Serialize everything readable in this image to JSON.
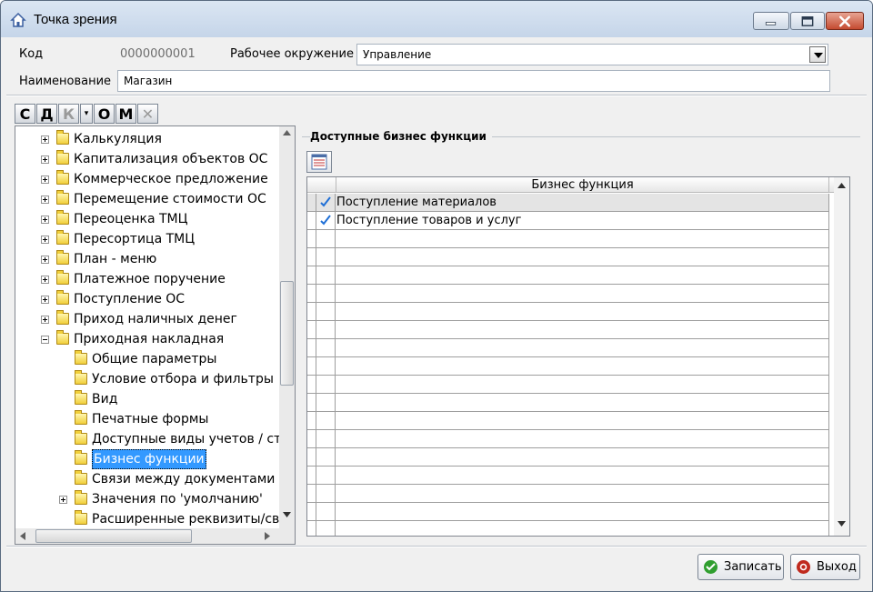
{
  "window": {
    "title": "Точка зрения",
    "icon": "home-icon"
  },
  "header": {
    "code_label": "Код",
    "code_value": "0000000001",
    "env_label": "Рабочее окружение",
    "env_value": "Управление",
    "name_label": "Наименование",
    "name_value": "Магазин"
  },
  "toolbar": {
    "buttons": [
      "С",
      "Д",
      "К",
      "▾",
      "О",
      "М",
      "✕"
    ]
  },
  "tree": {
    "items": [
      {
        "label": "Калькуляция",
        "level": 1,
        "expander": "plus"
      },
      {
        "label": "Капитализация объектов ОС",
        "level": 1,
        "expander": "plus"
      },
      {
        "label": "Коммерческое предложение",
        "level": 1,
        "expander": "plus"
      },
      {
        "label": "Перемещение стоимости ОС",
        "level": 1,
        "expander": "plus"
      },
      {
        "label": "Переоценка ТМЦ",
        "level": 1,
        "expander": "plus"
      },
      {
        "label": "Пересортица ТМЦ",
        "level": 1,
        "expander": "plus"
      },
      {
        "label": "План - меню",
        "level": 1,
        "expander": "plus"
      },
      {
        "label": "Платежное поручение",
        "level": 1,
        "expander": "plus"
      },
      {
        "label": "Поступление ОС",
        "level": 1,
        "expander": "plus"
      },
      {
        "label": "Приход наличных денег",
        "level": 1,
        "expander": "plus"
      },
      {
        "label": "Приходная накладная",
        "level": 1,
        "expander": "minus"
      },
      {
        "label": "Общие параметры",
        "level": 2,
        "expander": "none"
      },
      {
        "label": "Условие отбора и фильтры",
        "level": 2,
        "expander": "none"
      },
      {
        "label": "Вид",
        "level": 2,
        "expander": "none"
      },
      {
        "label": "Печатные формы",
        "level": 2,
        "expander": "none"
      },
      {
        "label": "Доступные виды учетов / ста",
        "level": 2,
        "expander": "none"
      },
      {
        "label": "Бизнес функции",
        "level": 2,
        "expander": "none",
        "selected": true
      },
      {
        "label": "Связи между документами",
        "level": 2,
        "expander": "none"
      },
      {
        "label": "Значения по 'умолчанию'",
        "level": 2,
        "expander": "plus"
      },
      {
        "label": "Расширенные реквизиты/сво",
        "level": 2,
        "expander": "none"
      }
    ]
  },
  "panel": {
    "group_title": "Доступные бизнес функции",
    "column_header": "Бизнес функция",
    "rows": [
      {
        "checked": true,
        "label": "Поступление материалов"
      },
      {
        "checked": true,
        "label": "Поступление товаров и услуг"
      }
    ]
  },
  "footer": {
    "save_label": "Записать",
    "exit_label": "Выход"
  },
  "colors": {
    "selection": "#3399ff",
    "check": "#1f6fd6",
    "save_icon": "#2f9e2f",
    "exit_icon": "#c02a1e"
  }
}
